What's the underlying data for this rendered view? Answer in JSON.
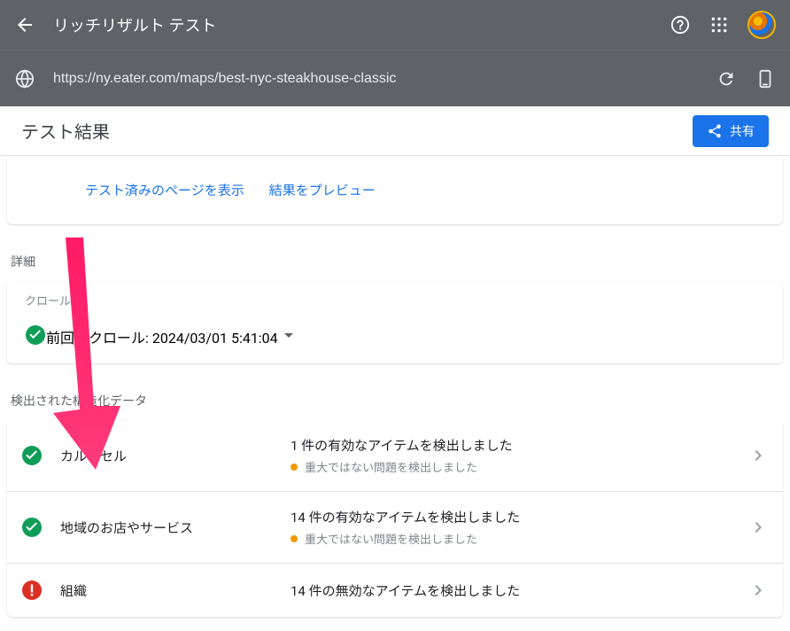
{
  "header": {
    "title": "リッチリザルト テスト"
  },
  "url_bar": {
    "url": "https://ny.eater.com/maps/best-nyc-steakhouse-classic"
  },
  "results": {
    "title": "テスト結果",
    "share_label": "共有"
  },
  "links": {
    "view_tested": "テスト済みのページを表示",
    "preview_results": "結果をプレビュー"
  },
  "sections": {
    "details_label": "詳細",
    "detected_label": "検出された構造化データ"
  },
  "crawl": {
    "label": "クロール",
    "text": "前回のクロール: 2024/03/01 5:41:04"
  },
  "items": [
    {
      "status": "ok",
      "name": "カルーセル",
      "main": "1 件の有効なアイテムを検出しました",
      "warn": "重大ではない問題を検出しました"
    },
    {
      "status": "ok",
      "name": "地域のお店やサービス",
      "main": "14 件の有効なアイテムを検出しました",
      "warn": "重大ではない問題を検出しました"
    },
    {
      "status": "error",
      "name": "組織",
      "main": "14 件の無効なアイテムを検出しました",
      "warn": null
    }
  ]
}
